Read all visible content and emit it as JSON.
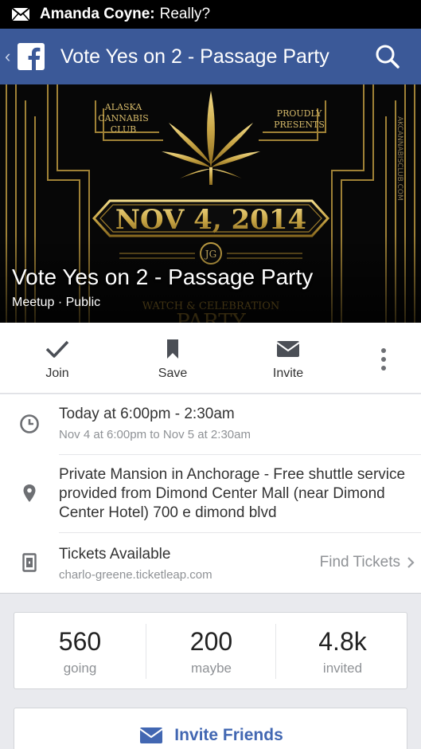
{
  "status_bar": {
    "sender": "Amanda Coyne:",
    "message": "Really?"
  },
  "header": {
    "title": "Vote Yes on 2 - Passage Party"
  },
  "cover": {
    "poster_text_left": "ALASKA\nCANNABIS\nCLUB",
    "poster_text_right": "PROUDLY\nPRESENTS",
    "poster_date": "NOV 4, 2014",
    "poster_bottom": "WATCH & CELEBRATION",
    "poster_bottom2": "PARTY",
    "poster_side": "AKCANNABISCLUB.COM",
    "poster_monogram": "JG",
    "event_title": "Vote Yes on 2 - Passage Party",
    "event_meta": "Meetup · Public"
  },
  "actions": {
    "join": "Join",
    "save": "Save",
    "invite": "Invite"
  },
  "time": {
    "main": "Today at 6:00pm - 2:30am",
    "sub": "Nov 4 at 6:00pm to Nov 5 at 2:30am"
  },
  "location": {
    "main": "Private Mansion in Anchorage - Free shuttle service provided from Dimond Center Mall (near Dimond Center Hotel) 700 e dimond blvd"
  },
  "tickets": {
    "main": "Tickets Available",
    "sub": "charlo-greene.ticketleap.com",
    "link": "Find Tickets"
  },
  "stats": [
    {
      "value": "560",
      "label": "going"
    },
    {
      "value": "200",
      "label": "maybe"
    },
    {
      "value": "4.8k",
      "label": "invited"
    }
  ],
  "invite_friends": {
    "label": "Invite Friends"
  },
  "colors": {
    "fb_blue": "#3b5998",
    "link_blue": "#4267b2",
    "gold": "#c9a646"
  }
}
